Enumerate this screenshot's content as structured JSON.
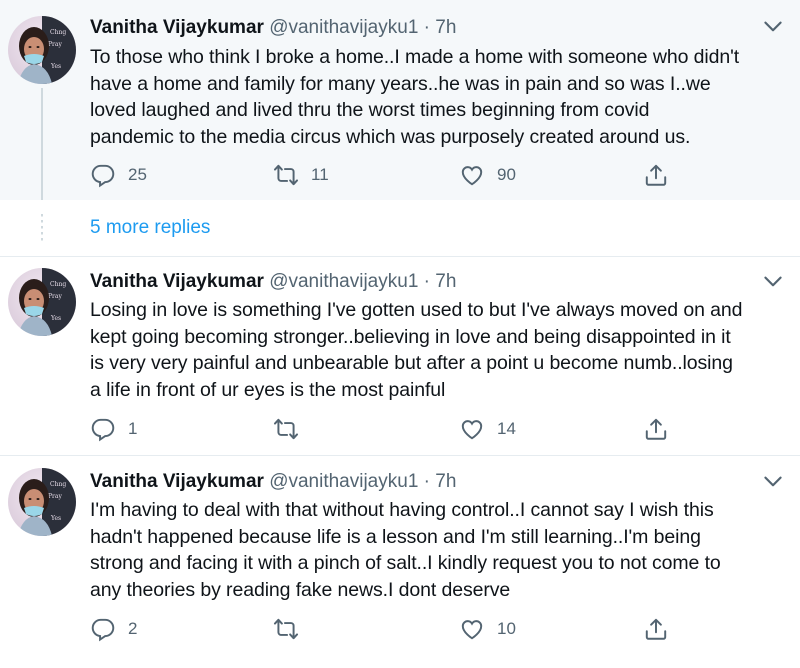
{
  "colors": {
    "accent": "#1d9bf0",
    "muted": "#536471",
    "highlight_bg": "#f5f8fa"
  },
  "tweets": [
    {
      "name": "Vanitha Vijaykumar",
      "handle": "@vanithavijayku1 · 7h",
      "text": "To those who think I broke a home..I made a home with someone who didn't\nhave a home and family for many years..he was in pain and so was I..we\nloved laughed and lived thru the worst times beginning from covid\npandemic to the media circus which was purposely created around us.",
      "replies": "25",
      "retweets": "11",
      "likes": "90"
    },
    {
      "name": "Vanitha Vijaykumar",
      "handle": "@vanithavijayku1 · 7h",
      "text": "Losing in love is something I've gotten used to but I've always moved on and\nkept going becoming stronger..believing in love and being disappointed in it\nis very very painful and unbearable but after a point u become numb..losing\na life in front of ur eyes is the most painful",
      "replies": "1",
      "retweets": "",
      "likes": "14"
    },
    {
      "name": "Vanitha Vijaykumar",
      "handle": "@vanithavijayku1 · 7h",
      "text": "I'm having to deal with that without having control..I cannot say I wish this\nhadn't happened because life is a lesson and I'm still learning..I'm being\nstrong and facing it with a pinch of salt..I kindly request you to not come to\nany theories by reading fake news.I dont deserve",
      "replies": "2",
      "retweets": "",
      "likes": "10"
    }
  ],
  "more_replies": "5 more replies",
  "icons": [
    "reply-icon",
    "retweet-icon",
    "like-icon",
    "share-icon",
    "chevron-down-icon"
  ]
}
